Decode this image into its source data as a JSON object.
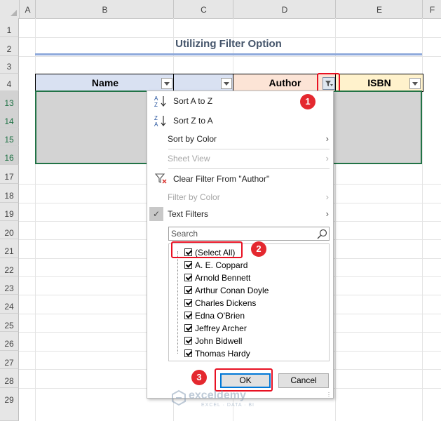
{
  "columns": [
    "A",
    "B",
    "C",
    "D",
    "E",
    "F"
  ],
  "rows": [
    "1",
    "2",
    "3",
    "4",
    "13",
    "14",
    "15",
    "16",
    "17",
    "18",
    "19",
    "20",
    "21",
    "22",
    "23",
    "24",
    "25",
    "26",
    "27",
    "28",
    "29"
  ],
  "title": "Utilizing Filter Option",
  "table_headers": {
    "name": "Name",
    "col_c": "",
    "author": "Author",
    "isbn": "ISBN"
  },
  "menu": {
    "sort_az": "Sort A to Z",
    "sort_za": "Sort Z to A",
    "sort_by_color": "Sort by Color",
    "sheet_view": "Sheet View",
    "clear_filter": "Clear Filter From \"Author\"",
    "filter_by_color": "Filter by Color",
    "text_filters": "Text Filters",
    "search_placeholder": "Search",
    "items": [
      "(Select All)",
      "A. E. Coppard",
      "Arnold Bennett",
      "Arthur Conan Doyle",
      "Charles Dickens",
      "Edna O'Brien",
      "Jeffrey Archer",
      "John Bidwell",
      "Thomas Hardy"
    ],
    "ok": "OK",
    "cancel": "Cancel"
  },
  "badges": [
    "1",
    "2",
    "3"
  ],
  "watermark": {
    "name": "exceldemy",
    "tagline": "EXCEL · DATA · BI"
  },
  "colors": {
    "accent_green": "#217346",
    "highlight_red": "#e81123",
    "header_blue": "#d9e1f2",
    "header_orange": "#fce4d6",
    "header_yellow": "#fff2cc"
  }
}
